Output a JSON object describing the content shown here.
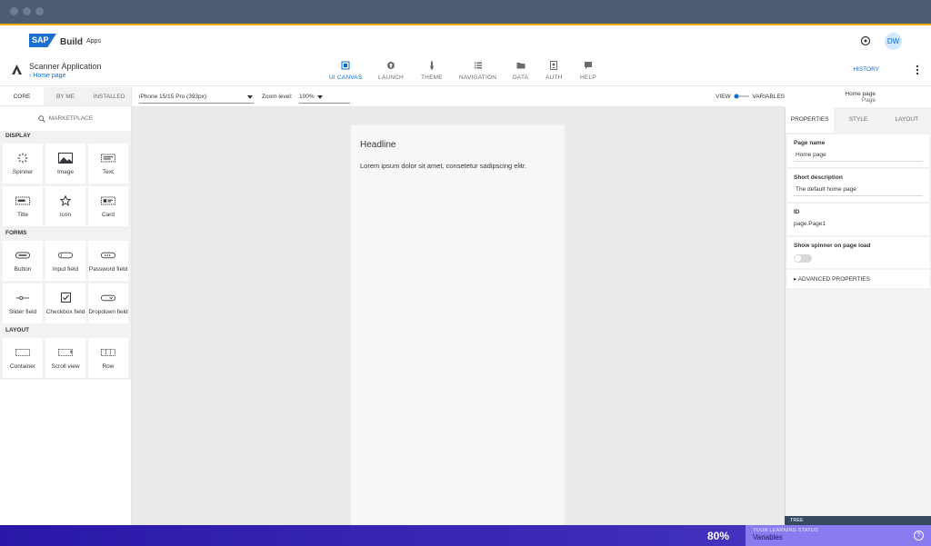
{
  "shell": {
    "brand": "Build",
    "brand_sub": "Apps",
    "logo_text": "SAP",
    "avatar": "DW"
  },
  "toolbar": {
    "app_name": "Scanner Application",
    "breadcrumb": "Home page",
    "nav": [
      {
        "label": "UI CANVAS",
        "icon": "ui-canvas-icon"
      },
      {
        "label": "LAUNCH",
        "icon": "launch-icon"
      },
      {
        "label": "THEME",
        "icon": "theme-icon"
      },
      {
        "label": "NAVIGATION",
        "icon": "navigation-icon"
      },
      {
        "label": "DATA",
        "icon": "data-icon"
      },
      {
        "label": "AUTH",
        "icon": "auth-icon"
      },
      {
        "label": "HELP",
        "icon": "help-icon"
      }
    ],
    "history": "HISTORY"
  },
  "left": {
    "tabs": [
      "CORE",
      "BY ME",
      "INSTALLED"
    ],
    "marketplace": "MARKETPLACE",
    "sections": [
      {
        "title": "DISPLAY",
        "items": [
          "Spinner",
          "Image",
          "Text",
          "Title",
          "Icon",
          "Card"
        ]
      },
      {
        "title": "FORMS",
        "items": [
          "Button",
          "Input field",
          "Password field",
          "Slider field",
          "Checkbox field",
          "Dropdown field"
        ]
      },
      {
        "title": "LAYOUT",
        "items": [
          "Container",
          "Scroll view",
          "Row"
        ]
      }
    ]
  },
  "canvasbar": {
    "device": "iPhone 15/15 Pro (393px)",
    "zoom_label": "Zoom level:",
    "zoom_value": "100%",
    "view": "VIEW",
    "variables": "VARIABLES"
  },
  "page_header": {
    "title": "Home page",
    "subtitle": "Page"
  },
  "canvas": {
    "headline": "Headline",
    "body": "Lorem ipsum dolor sit amet, consetetur sadipscing elitr."
  },
  "right": {
    "tabs": [
      "PROPERTIES",
      "STYLE",
      "LAYOUT"
    ],
    "page_name_label": "Page name",
    "page_name": "Home page",
    "short_desc_label": "Short description",
    "short_desc": "The default home page",
    "id_label": "ID",
    "id_value": "page.Page1",
    "spinner_label": "Show spinner on page load",
    "spinner_on": false,
    "advanced": "ADVANCED PROPERTIES",
    "tree": "TREE"
  },
  "status": {
    "percent": "80%",
    "learning_label": "YOUR LEARNING STATUS",
    "learning_value": "Variables",
    "help": "?"
  },
  "colors": {
    "accent": "#0a6ed1",
    "titlebar": "#4c5d72",
    "statusbar": "#2a19a8",
    "learn": "#8a7cf0"
  }
}
